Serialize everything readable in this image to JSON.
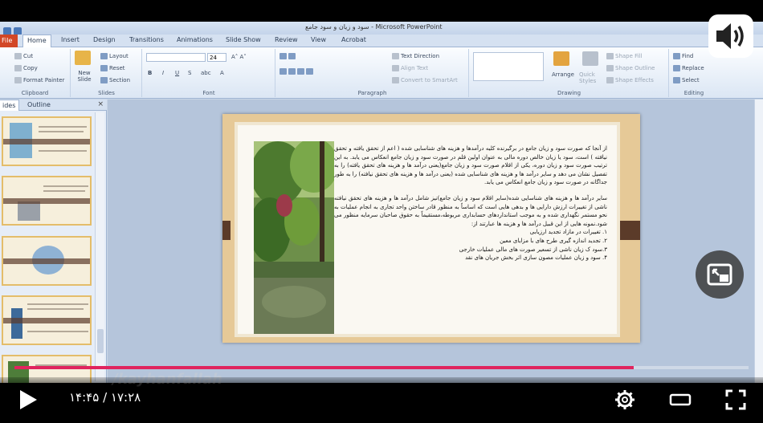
{
  "window": {
    "title": "سود و زیان و سود جامع - Microsoft PowerPoint"
  },
  "ribbon": {
    "file_tab": "File",
    "tabs": [
      "Home",
      "Insert",
      "Design",
      "Transitions",
      "Animations",
      "Slide Show",
      "Review",
      "View",
      "Acrobat"
    ],
    "active_tab": "Home",
    "clipboard": {
      "cut": "Cut",
      "copy": "Copy",
      "format_painter": "Format Painter",
      "label": "Clipboard"
    },
    "slides": {
      "new_slide": "New Slide",
      "layout": "Layout",
      "reset": "Reset",
      "section": "Section",
      "label": "Slides"
    },
    "font": {
      "size": "24",
      "label": "Font"
    },
    "paragraph": {
      "text_direction": "Text Direction",
      "align_text": "Align Text",
      "convert_smartart": "Convert to SmartArt",
      "label": "Paragraph"
    },
    "drawing": {
      "arrange": "Arrange",
      "quick_styles": "Quick Styles",
      "shape_fill": "Shape Fill",
      "shape_outline": "Shape Outline",
      "shape_effects": "Shape Effects",
      "label": "Drawing"
    },
    "editing": {
      "find": "Find",
      "replace": "Replace",
      "select": "Select",
      "label": "Editing"
    }
  },
  "left_pane": {
    "tab_slides": "ides",
    "tab_outline": "Outline",
    "close": "×"
  },
  "slide": {
    "paragraph1": "از آنجا که صورت سود و زیان جامع در برگیرنده کلیه درآمدها و هزینه های شناسایی شده ( اعم از تحقق یافته و تحقق نیافته ) است، سود یا زیان خالص دوره مالی به عنوان اولین قلم در صورت سود و زیان جامع انعکاس می یابد. به این ترتیب صورت سود و زیان دوره، یکی از اقلام صورت سود و زیان جامع(یعنی درآمد ها و هزینه های تحقق یافته) را به تفصیل نشان می دهد و سایر درآمد ها و هزینه های شناسایی شده (یعنی درآمد ها و هزینه های تحقق نیافته) را به طور جداگانه در صورت سود و زیان جامع انعکاس می یابد.",
    "paragraph2": "سایر درآمد ها و هزینه های شناسایی شده(سایر اقلام سود و زیان جامع)نیز شامل درآمد ها و هزینه های تحقق نیافته ناشی از تغییرات ارزش دارایی ها و بدهی هایی است که اساساً به منظور قادر ساختن واحد تجاری به انجام عملیات به نحو مستمر نگهداری شده و به موجب استانداردهای حسابداری مربوطه،مستقیماً به حقوق صاحبان سرمایه منظور می شود.نمونه هایی از این قبیل درآمد ها و هزینه ها عبارتند از:",
    "list": [
      "۱. تغییرات در مازاد تجدید ارزیابی",
      "۲. تجدید اندازه گیری طرح های با مزایای معین",
      "۳.سود ک زیان ناشی از تسعیر صورت های مالی عملیات خارجی",
      "۴. سود و زیان عملیات مصون سازی اثر بخش جریان  های نقد"
    ]
  },
  "video": {
    "watermark": "/kayhanfallah",
    "time_current": "۱۴:۴۵",
    "time_separator": "/",
    "time_total": "۱۷:۲۸",
    "progress_fraction": 0.843,
    "accent_color": "#e0245e"
  }
}
